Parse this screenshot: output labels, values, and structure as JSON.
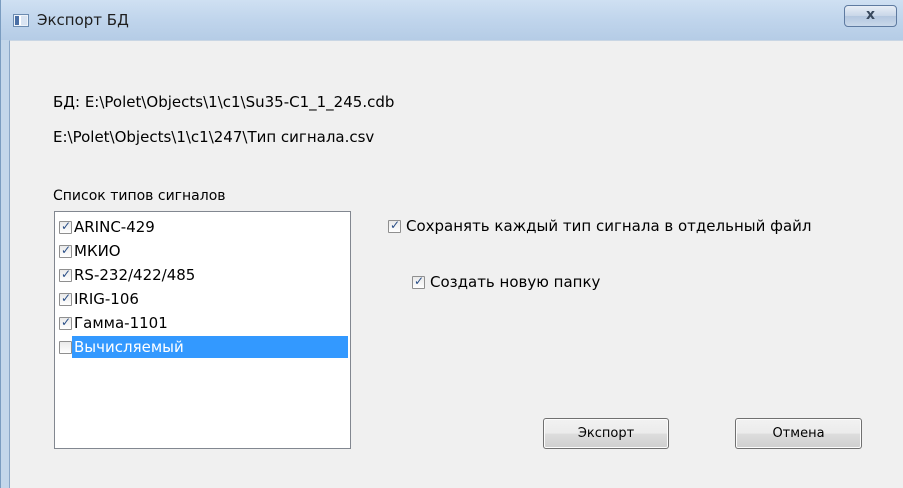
{
  "window": {
    "title": "Экспорт БД",
    "close_label": "x"
  },
  "db_path": "БД:  E:\\Polet\\Objects\\1\\c1\\Su35-C1_1_245.cdb",
  "csv_path": "E:\\Polet\\Objects\\1\\c1\\247\\Тип сигнала.csv",
  "signal_list": {
    "label": "Список типов сигналов",
    "items": [
      {
        "label": "ARINC-429",
        "checked": true
      },
      {
        "label": "МКИО",
        "checked": true
      },
      {
        "label": "RS-232/422/485",
        "checked": true
      },
      {
        "label": "IRIG-106",
        "checked": true
      },
      {
        "label": "Гамма-1101",
        "checked": true
      },
      {
        "label": "Вычисляемый",
        "checked": false,
        "selected": true
      }
    ]
  },
  "options": {
    "separate_files": {
      "label": "Сохранять каждый тип сигнала в отдельный файл",
      "checked": true
    },
    "new_folder": {
      "label": "Создать новую папку",
      "checked": true
    }
  },
  "buttons": {
    "export": "Экспорт",
    "cancel": "Отмена"
  }
}
